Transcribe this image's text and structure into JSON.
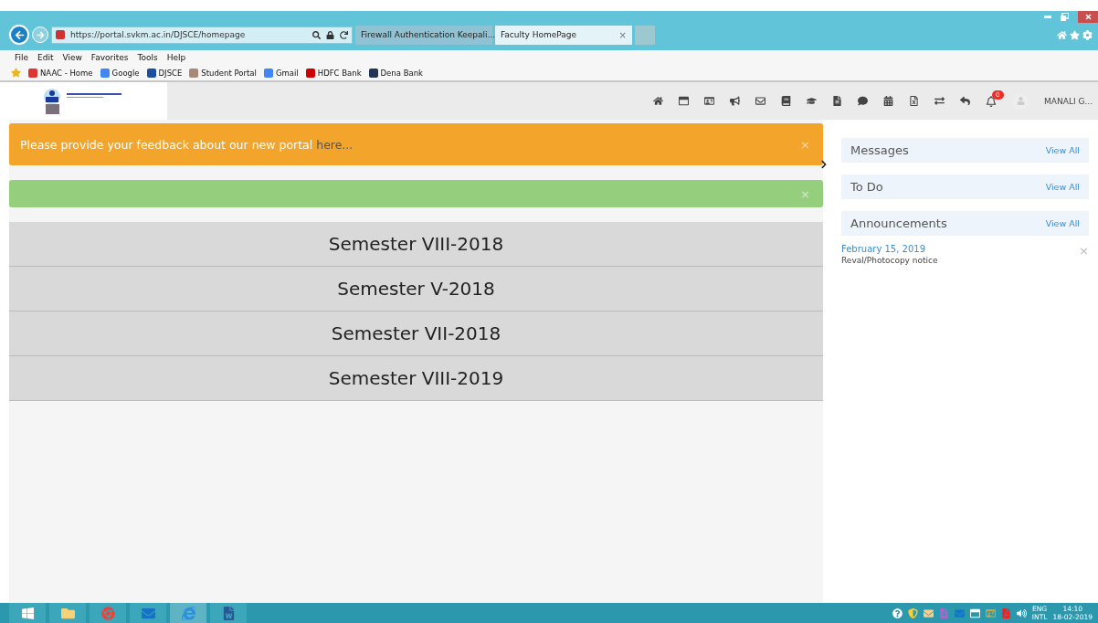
{
  "browser": {
    "address": "https://portal.svkm.ac.in/DJSCE/homepage",
    "tabs": [
      {
        "title": "Firewall Authentication Keepali...",
        "selected": false
      },
      {
        "title": "Faculty HomePage",
        "selected": true,
        "close": "×"
      }
    ],
    "menu": [
      "File",
      "Edit",
      "View",
      "Favorites",
      "Tools",
      "Help"
    ],
    "favorites": [
      "NAAC - Home",
      "Google",
      "DJSCE",
      "Student Portal",
      "Gmail",
      "HDFC Bank",
      "Dena Bank"
    ]
  },
  "header": {
    "notification_count": "0",
    "user": "MANALI G..."
  },
  "alerts": [
    {
      "kind": "feedback",
      "text": "Please provide your feedback about our new portal ",
      "link": "here...",
      "close": "×"
    },
    {
      "kind": "success",
      "close": "×"
    }
  ],
  "semesters": [
    "Semester VIII-2018",
    "Semester V-2018",
    "Semester VII-2018",
    "Semester VIII-2019"
  ],
  "sidebar": {
    "panels": [
      {
        "title": "Messages",
        "action": "View All"
      },
      {
        "title": "To Do",
        "action": "View All"
      },
      {
        "title": "Announcements",
        "action": "View All"
      }
    ],
    "announcements": [
      {
        "date": "February 15, 2019",
        "text": "Reval/Photocopy notice",
        "close": "×"
      }
    ]
  },
  "taskbar": {
    "language": "ENG",
    "layout": "INTL",
    "time": "14:10",
    "date": "18-02-2019"
  }
}
